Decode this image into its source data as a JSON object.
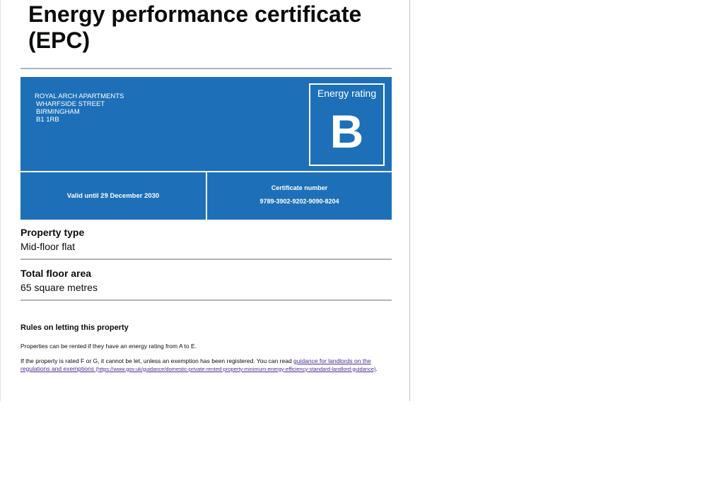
{
  "header": {
    "title_line1": "Energy performance certificate",
    "title_line2": "(EPC)"
  },
  "property": {
    "address_lines": [
      "ROYAL ARCH APARTMENTS",
      "WHARFSIDE STREET",
      "BIRMINGHAM",
      "B1 1RB"
    ],
    "energy_rating_label": "Energy rating",
    "energy_rating": "B",
    "valid_until": "Valid until 29 December 2030",
    "certificate_number_label": "Certificate number",
    "certificate_number": "9789-3902-9202-9090-8204"
  },
  "details": {
    "property_type_label": "Property type",
    "property_type": "Mid-floor flat",
    "floor_area_label": "Total floor area",
    "floor_area": "65 square metres"
  },
  "rules": {
    "heading": "Rules on letting this property",
    "para1": "Properties can be rented if they have an energy rating from A to E.",
    "para2_text": "If the property is rated F or G, it cannot be let, unless an exemption has been registered. You can read ",
    "link_text": "guidance for landlords on the regulations and exemptions",
    "link_url": "(https://www.gov.uk/guidance/domestic-private-rented-property-minimum-energy-efficiency-standard-landlord-guidance)",
    "para2_end": "."
  },
  "colors": {
    "hero_background": "#1d70b8",
    "text": "#0b0c0c",
    "rule": "#b1b4b6",
    "link": "#4c2c92"
  }
}
